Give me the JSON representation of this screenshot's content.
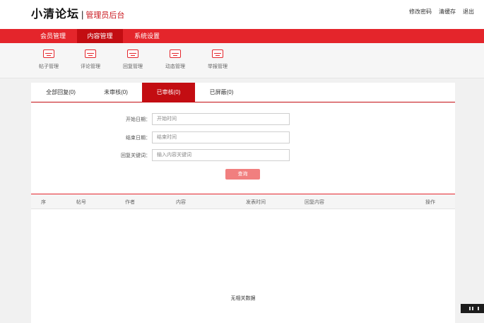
{
  "header": {
    "title": "小清论坛",
    "separator": "|",
    "subtitle": "管理员后台",
    "links": [
      "修改密码",
      "清缓存",
      "退出"
    ]
  },
  "nav": {
    "items": [
      "会员管理",
      "内容管理",
      "系统设置"
    ],
    "active": 1
  },
  "subnav": {
    "items": [
      "帖子管理",
      "评论管理",
      "回复管理",
      "动态管理",
      "举报管理"
    ]
  },
  "tabs": {
    "items": [
      "全部回复(0)",
      "未审核(0)",
      "已审核(0)",
      "已屏蔽(0)"
    ],
    "active": 2
  },
  "filters": {
    "start_label": "开始日期：",
    "start_placeholder": "开始时间",
    "end_label": "结束日期：",
    "end_placeholder": "结束时间",
    "keyword_label": "回复关键词：",
    "keyword_placeholder": "输入内容关键词",
    "search_label": "查询"
  },
  "table": {
    "columns": [
      "序",
      "帖号",
      "作者",
      "内容",
      "发表时间",
      "回复内容",
      "操作"
    ],
    "empty_text": "无相关数据"
  },
  "colors": {
    "brand_red": "#e4252b",
    "active_red": "#c30d12",
    "button_pink": "#f17f7f"
  }
}
